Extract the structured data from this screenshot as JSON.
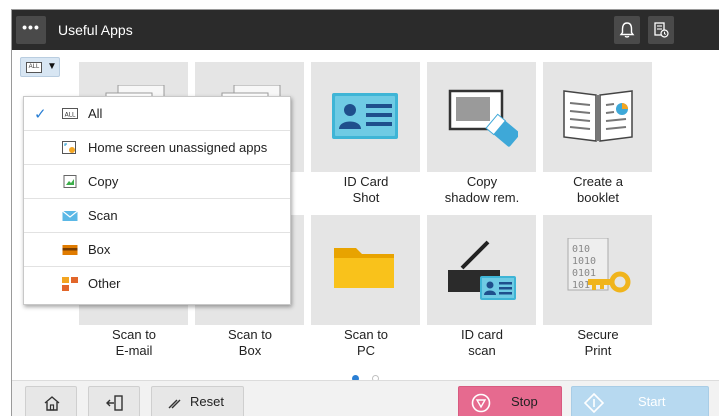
{
  "header": {
    "menu_glyph": "•••",
    "title": "Useful Apps"
  },
  "filter": {
    "badge": "ALL",
    "caret": "▼"
  },
  "apps": [
    {
      "label_line1": "",
      "label_line2": ""
    },
    {
      "label_line1": "",
      "label_line2": ""
    },
    {
      "label_line1": "ID Card",
      "label_line2": "Shot"
    },
    {
      "label_line1": "Copy",
      "label_line2": "shadow rem."
    },
    {
      "label_line1": "Create a",
      "label_line2": "booklet"
    },
    {
      "label_line1": "Scan to",
      "label_line2": "E-mail"
    },
    {
      "label_line1": "Scan to",
      "label_line2": "Box"
    },
    {
      "label_line1": "Scan to",
      "label_line2": "PC"
    },
    {
      "label_line1": "ID card",
      "label_line2": "scan"
    },
    {
      "label_line1": "Secure",
      "label_line2": "Print"
    }
  ],
  "dropdown": {
    "items": [
      {
        "label": "All",
        "icon": "all-icon",
        "selected": true
      },
      {
        "label": "Home screen unassigned apps",
        "icon": "unassigned-apps-icon",
        "selected": false
      },
      {
        "label": "Copy",
        "icon": "copy-icon",
        "selected": false
      },
      {
        "label": "Scan",
        "icon": "scan-icon",
        "selected": false
      },
      {
        "label": "Box",
        "icon": "box-icon",
        "selected": false
      },
      {
        "label": "Other",
        "icon": "other-icon",
        "selected": false
      }
    ],
    "check_glyph": "✓",
    "all_badge": "ALL"
  },
  "pagination": {
    "pages": 2,
    "current": 1
  },
  "bottom": {
    "reset_label": "Reset",
    "stop_label": "Stop",
    "start_label": "Start"
  },
  "colors": {
    "header_bg": "#2b2b2b",
    "accent": "#2a7fd4",
    "stop": "#e66a8f",
    "start_disabled": "#b7d9f0",
    "tile_bg": "#e5e5e5"
  }
}
